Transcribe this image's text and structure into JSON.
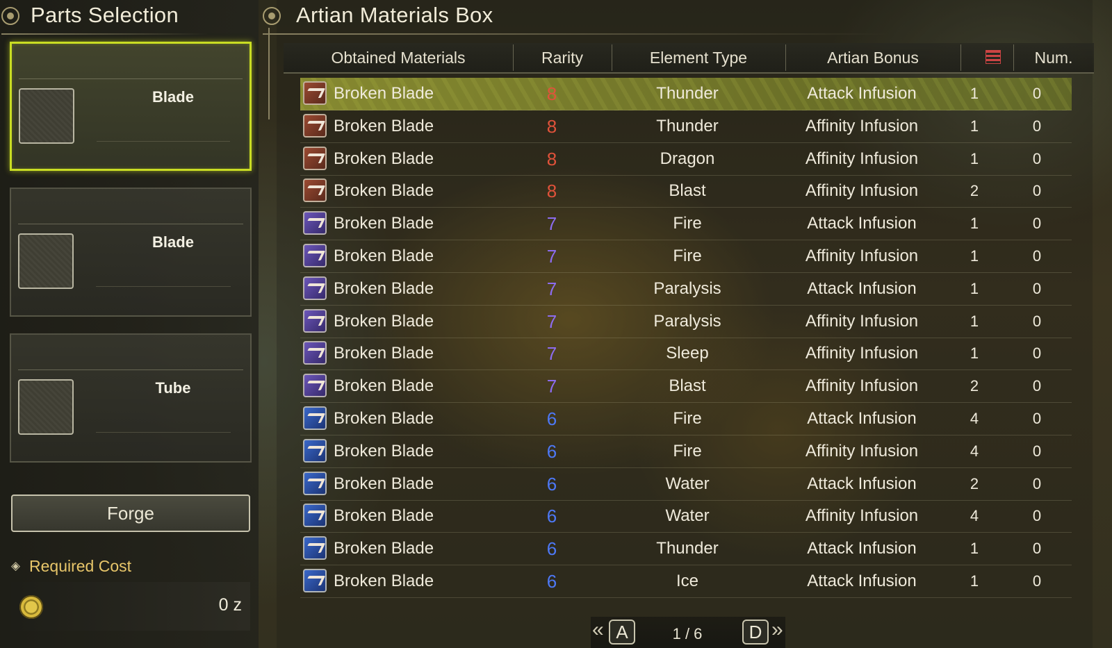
{
  "left_panel": {
    "title": "Parts Selection",
    "parts": [
      {
        "label": "Blade",
        "selected": true
      },
      {
        "label": "Blade",
        "selected": false
      },
      {
        "label": "Tube",
        "selected": false
      }
    ],
    "forge_label": "Forge",
    "required_cost_label": "Required Cost",
    "cost_value": "0 z"
  },
  "main": {
    "title": "Artian Materials Box",
    "columns": {
      "name": "Obtained Materials",
      "rarity": "Rarity",
      "element": "Element Type",
      "bonus": "Artian Bonus",
      "num": "Num."
    },
    "rarity_colors": {
      "8": "#e0523a",
      "7": "#8d6cf0",
      "6": "#4d78f5"
    },
    "rows": [
      {
        "name": "Broken Blade",
        "rarity": "8",
        "element": "Thunder",
        "bonus": "Attack Infusion",
        "qty": "1",
        "num": "0"
      },
      {
        "name": "Broken Blade",
        "rarity": "8",
        "element": "Thunder",
        "bonus": "Affinity Infusion",
        "qty": "1",
        "num": "0"
      },
      {
        "name": "Broken Blade",
        "rarity": "8",
        "element": "Dragon",
        "bonus": "Affinity Infusion",
        "qty": "1",
        "num": "0"
      },
      {
        "name": "Broken Blade",
        "rarity": "8",
        "element": "Blast",
        "bonus": "Affinity Infusion",
        "qty": "2",
        "num": "0"
      },
      {
        "name": "Broken Blade",
        "rarity": "7",
        "element": "Fire",
        "bonus": "Attack Infusion",
        "qty": "1",
        "num": "0"
      },
      {
        "name": "Broken Blade",
        "rarity": "7",
        "element": "Fire",
        "bonus": "Affinity Infusion",
        "qty": "1",
        "num": "0"
      },
      {
        "name": "Broken Blade",
        "rarity": "7",
        "element": "Paralysis",
        "bonus": "Attack Infusion",
        "qty": "1",
        "num": "0"
      },
      {
        "name": "Broken Blade",
        "rarity": "7",
        "element": "Paralysis",
        "bonus": "Affinity Infusion",
        "qty": "1",
        "num": "0"
      },
      {
        "name": "Broken Blade",
        "rarity": "7",
        "element": "Sleep",
        "bonus": "Affinity Infusion",
        "qty": "1",
        "num": "0"
      },
      {
        "name": "Broken Blade",
        "rarity": "7",
        "element": "Blast",
        "bonus": "Affinity Infusion",
        "qty": "2",
        "num": "0"
      },
      {
        "name": "Broken Blade",
        "rarity": "6",
        "element": "Fire",
        "bonus": "Attack Infusion",
        "qty": "4",
        "num": "0"
      },
      {
        "name": "Broken Blade",
        "rarity": "6",
        "element": "Fire",
        "bonus": "Affinity Infusion",
        "qty": "4",
        "num": "0"
      },
      {
        "name": "Broken Blade",
        "rarity": "6",
        "element": "Water",
        "bonus": "Attack Infusion",
        "qty": "2",
        "num": "0"
      },
      {
        "name": "Broken Blade",
        "rarity": "6",
        "element": "Water",
        "bonus": "Affinity Infusion",
        "qty": "4",
        "num": "0"
      },
      {
        "name": "Broken Blade",
        "rarity": "6",
        "element": "Thunder",
        "bonus": "Attack Infusion",
        "qty": "1",
        "num": "0"
      },
      {
        "name": "Broken Blade",
        "rarity": "6",
        "element": "Ice",
        "bonus": "Attack Infusion",
        "qty": "1",
        "num": "0"
      }
    ],
    "selected_row": 0
  },
  "pager": {
    "prev_key": "A",
    "next_key": "D",
    "page_text": "1 / 6"
  }
}
